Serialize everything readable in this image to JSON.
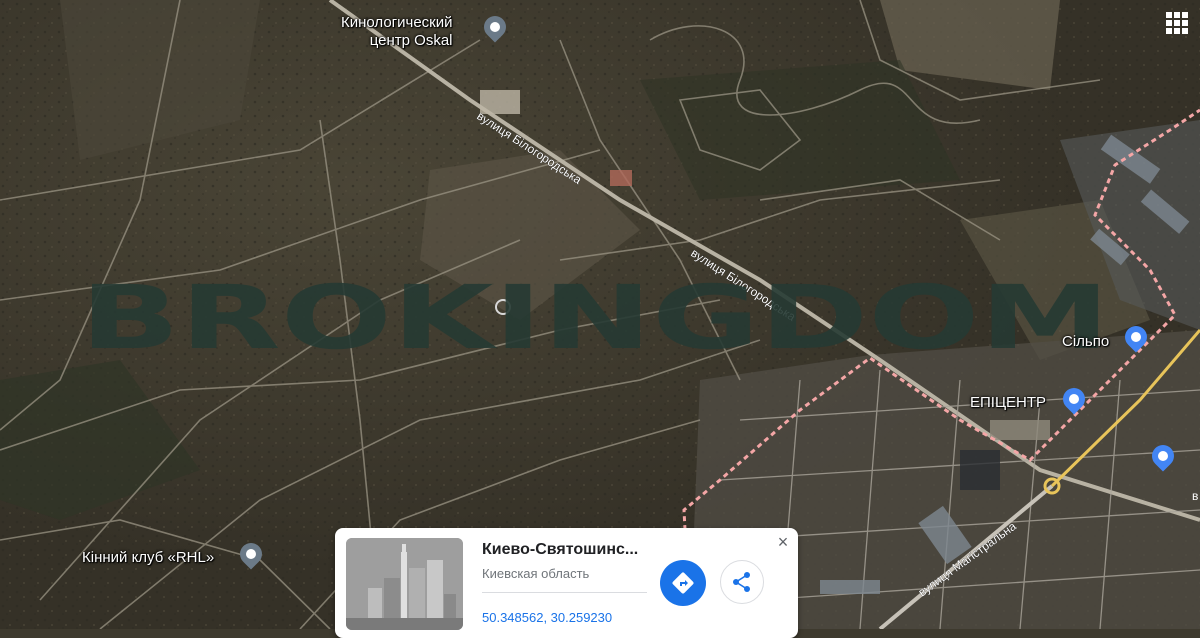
{
  "map": {
    "place_labels": [
      {
        "id": "kinolog",
        "line1": "Кинологический",
        "line2": "центр Oskal"
      },
      {
        "id": "silpo",
        "text": "Сільпо"
      },
      {
        "id": "epicentr",
        "text": "ЕПІЦЕНТР"
      },
      {
        "id": "rhl",
        "text": "Кінний клуб «RHL»"
      }
    ],
    "road_labels": {
      "bilohorodska_1": "вулиця Білогородська",
      "bilohorodska_2": "вулиця Білогородська",
      "mahistralna": "вулиця Магістральна",
      "edge": "в"
    },
    "watermark": "BROKINGDOM",
    "colors": {
      "pin_gray": "#6b7a88",
      "pin_blue": "#4285f4",
      "boundary": "#f4a6a6",
      "highway": "#e8c45a"
    }
  },
  "info_card": {
    "title": "Киево-Святошинс...",
    "subtitle": "Киевская область",
    "coords": "50.348562, 30.259230",
    "close_label": "×"
  }
}
